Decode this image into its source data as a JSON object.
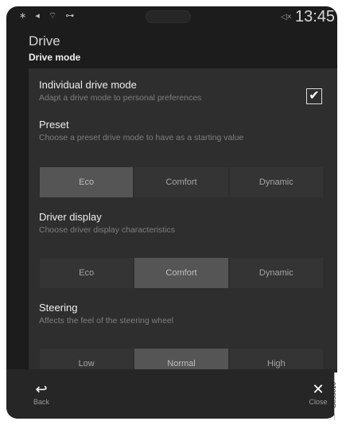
{
  "statusbar": {
    "icons": "∗ ◂ ⌔ ⊶",
    "volume_icon": "speaker-mute-icon",
    "volume_glyph": "◁×",
    "time": "13:45"
  },
  "header": {
    "title": "Drive",
    "subtitle": "Drive mode"
  },
  "individual": {
    "title": "Individual drive mode",
    "desc": "Adapt a drive mode to personal preferences",
    "checked": true,
    "check_glyph": "✔"
  },
  "preset": {
    "title": "Preset",
    "desc": "Choose a preset drive mode to have as a starting value",
    "options": [
      "Eco",
      "Comfort",
      "Dynamic"
    ],
    "selected": "Eco"
  },
  "driver_display": {
    "title": "Driver display",
    "desc": "Choose driver display characteristics",
    "options": [
      "Eco",
      "Comfort",
      "Dynamic"
    ],
    "selected": "Comfort"
  },
  "steering": {
    "title": "Steering",
    "desc": "Affects the feel of the steering wheel",
    "options": [
      "Low",
      "Normal",
      "High"
    ],
    "selected": "Normal"
  },
  "footer": {
    "back_label": "Back",
    "back_glyph": "↩",
    "close_label": "Close",
    "close_glyph": "✕"
  },
  "image_code": "G053816"
}
